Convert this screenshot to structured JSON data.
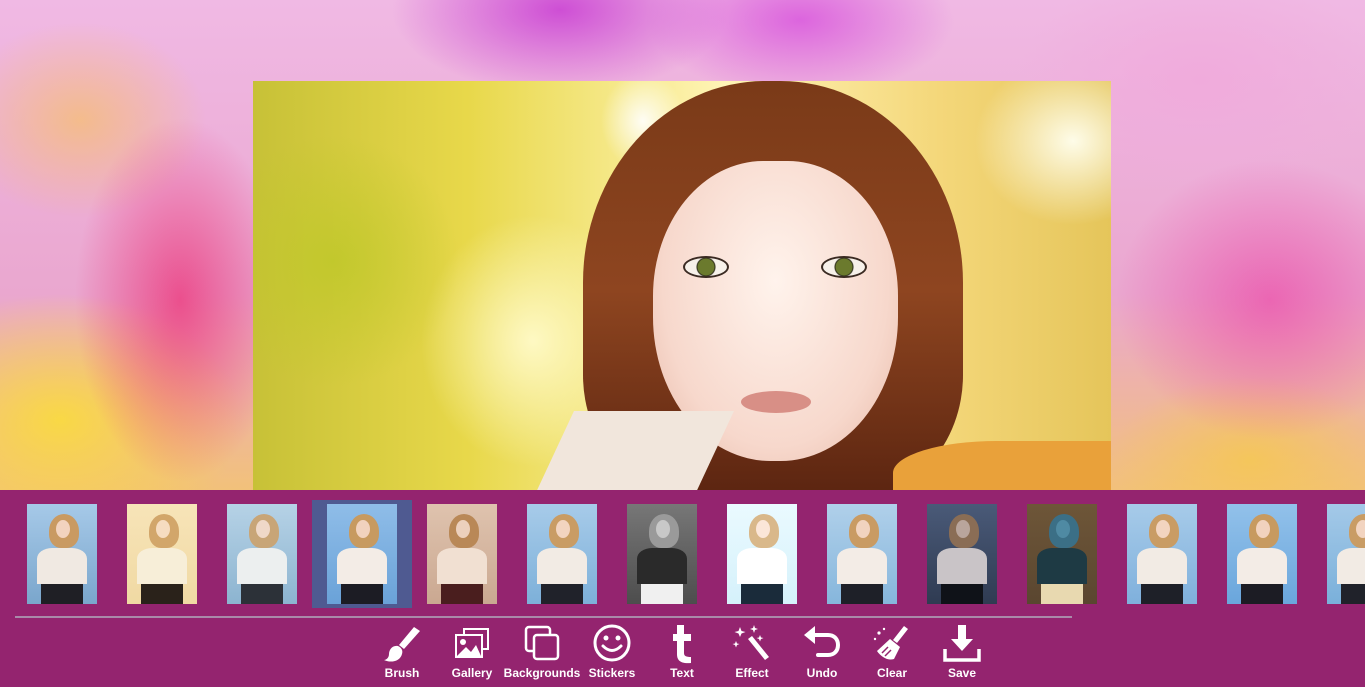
{
  "canvas": {
    "image_alt": "Portrait photo of a young woman with auburn hair against a sunny bokeh background"
  },
  "filters": {
    "selected_index": 3,
    "items": [
      {
        "tone": "#7aa6cc",
        "sky": "#a6c9e8",
        "top": "#f0e9e2",
        "bottom": "#1f1f25",
        "hair": "#c99a62",
        "face": "#f2d3bf"
      },
      {
        "tone": "#f0d9a3",
        "sky": "#f7e4b8",
        "top": "#f7eed8",
        "bottom": "#2a221a",
        "hair": "#d2a66a",
        "face": "#f6dcc0"
      },
      {
        "tone": "#8cb4d0",
        "sky": "#b6d2e6",
        "top": "#ecefef",
        "bottom": "#2c3138",
        "hair": "#c8a577",
        "face": "#efd8c8"
      },
      {
        "tone": "#6aa2d8",
        "sky": "#8fbde8",
        "top": "#f3ece6",
        "bottom": "#1c1c24",
        "hair": "#c79a60",
        "face": "#f1d2be"
      },
      {
        "tone": "#caa891",
        "sky": "#dfc3ae",
        "top": "#f1e0d2",
        "bottom": "#4a1e1e",
        "hair": "#b98857",
        "face": "#ecd0bd"
      },
      {
        "tone": "#7db0d9",
        "sky": "#a7cbe9",
        "top": "#f2ebe4",
        "bottom": "#20222a",
        "hair": "#c99c64",
        "face": "#f2d4c0"
      },
      {
        "tone": "#4d4d4d",
        "sky": "#777777",
        "top": "#2a2a2a",
        "bottom": "#f0f0f0",
        "hair": "#9a9a9a",
        "face": "#c8c8c8"
      },
      {
        "tone": "#d5f1fb",
        "sky": "#eafaff",
        "top": "#ffffff",
        "bottom": "#1a2b3a",
        "hair": "#d9b88a",
        "face": "#fbe6d8"
      },
      {
        "tone": "#86b6dc",
        "sky": "#b0d0ea",
        "top": "#f3ece6",
        "bottom": "#1e2028",
        "hair": "#c99b63",
        "face": "#f1d3bf"
      },
      {
        "tone": "#2f3b52",
        "sky": "#4a5a78",
        "top": "#c9c4c7",
        "bottom": "#0f1218",
        "hair": "#8a6d55",
        "face": "#b9a59c"
      },
      {
        "tone": "#5a4630",
        "sky": "#6e5638",
        "top": "#1e3a44",
        "bottom": "#e8d9b0",
        "hair": "#3b6f86",
        "face": "#4f8aa3"
      },
      {
        "tone": "#7fb0dc",
        "sky": "#a7cbe9",
        "top": "#f2ebe4",
        "bottom": "#1e2028",
        "hair": "#c99c64",
        "face": "#f2d4c0"
      },
      {
        "tone": "#6aa6dc",
        "sky": "#92c1ea",
        "top": "#f3ece6",
        "bottom": "#1c1c24",
        "hair": "#c79a60",
        "face": "#f1d2be"
      },
      {
        "tone": "#7ab0da",
        "sky": "#a4c9e8",
        "top": "#f2ebe4",
        "bottom": "#20222a",
        "hair": "#c99c64",
        "face": "#f2d4c0"
      }
    ]
  },
  "toolbar": {
    "brush_label": "Brush",
    "gallery_label": "Gallery",
    "backgrounds_label": "Backgrounds",
    "stickers_label": "Stickers",
    "text_label": "Text",
    "effect_label": "Effect",
    "undo_label": "Undo",
    "clear_label": "Clear",
    "save_label": "Save"
  },
  "colors": {
    "bar": "#94246f",
    "selected": "#4f5a91",
    "icon": "#ffffff"
  }
}
